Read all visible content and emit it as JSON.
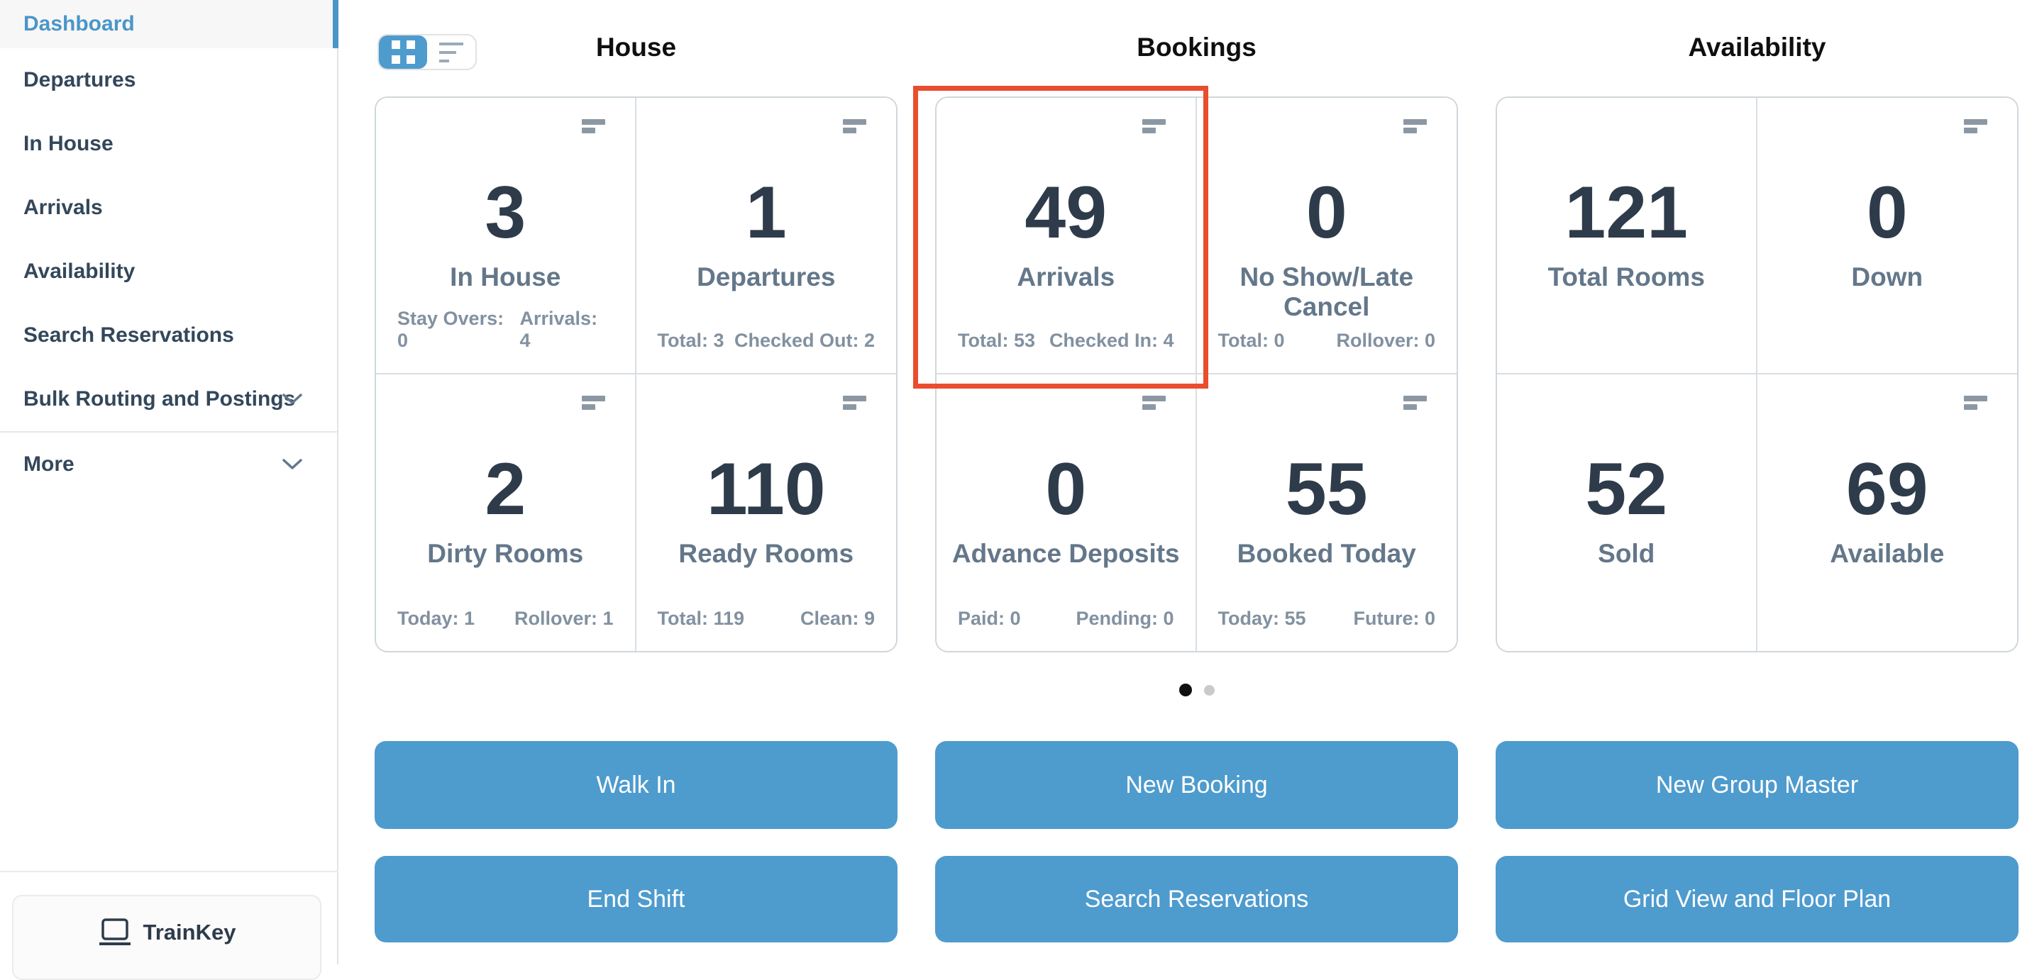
{
  "sidebar": {
    "items": [
      {
        "label": "Dashboard",
        "active": true
      },
      {
        "label": "Departures"
      },
      {
        "label": "In House"
      },
      {
        "label": "Arrivals"
      },
      {
        "label": "Availability"
      },
      {
        "label": "Search Reservations"
      },
      {
        "label": "Bulk Routing and Postings",
        "expandable": true
      },
      {
        "label": "More",
        "expandable": true
      }
    ],
    "footer": {
      "label": "TrainKey",
      "icon": "laptop-icon"
    }
  },
  "view_toggle": {
    "active_view": "grid",
    "options": [
      "grid-view",
      "list-view"
    ]
  },
  "sections": [
    {
      "title": "House",
      "tiles": [
        {
          "value": "3",
          "label": "In House",
          "stat_left": "Stay Overs: 0",
          "stat_right": "Arrivals: 4",
          "menu": true
        },
        {
          "value": "1",
          "label": "Departures",
          "stat_left": "Total: 3",
          "stat_right": "Checked Out: 2",
          "menu": true
        },
        {
          "value": "2",
          "label": "Dirty Rooms",
          "stat_left": "Today: 1",
          "stat_right": "Rollover: 1",
          "menu": true
        },
        {
          "value": "110",
          "label": "Ready Rooms",
          "stat_left": "Total: 119",
          "stat_right": "Clean: 9",
          "menu": true
        }
      ]
    },
    {
      "title": "Bookings",
      "highlighted_tile": "Arrivals",
      "tiles": [
        {
          "value": "49",
          "label": "Arrivals",
          "stat_left": "Total: 53",
          "stat_right": "Checked In: 4",
          "menu": true,
          "highlighted": true
        },
        {
          "value": "0",
          "label": "No Show/Late Cancel",
          "stat_left": "Total: 0",
          "stat_right": "Rollover: 0",
          "menu": true
        },
        {
          "value": "0",
          "label": "Advance Deposits",
          "stat_left": "Paid: 0",
          "stat_right": "Pending: 0",
          "menu": true
        },
        {
          "value": "55",
          "label": "Booked Today",
          "stat_left": "Today: 55",
          "stat_right": "Future: 0",
          "menu": true
        }
      ]
    },
    {
      "title": "Availability",
      "tiles": [
        {
          "value": "121",
          "label": "Total Rooms"
        },
        {
          "value": "0",
          "label": "Down",
          "menu": true
        },
        {
          "value": "52",
          "label": "Sold"
        },
        {
          "value": "69",
          "label": "Available",
          "menu": true
        }
      ]
    }
  ],
  "carousel": {
    "dot_count": 2,
    "active_index": 0
  },
  "action_buttons": {
    "row1": [
      "Walk In",
      "New Booking",
      "New Group Master"
    ],
    "row2": [
      "End Shift",
      "Search Reservations",
      "Grid View and Floor Plan"
    ]
  },
  "colors": {
    "accent_blue": "#4e9bce",
    "sidebar_active_blue": "#4a96c8",
    "highlight_red": "#e84e2d",
    "number_navy": "#2e3b4a",
    "label_slate": "#64778a",
    "stats_gray": "#8291a0",
    "card_border": "#d0d7dc"
  }
}
